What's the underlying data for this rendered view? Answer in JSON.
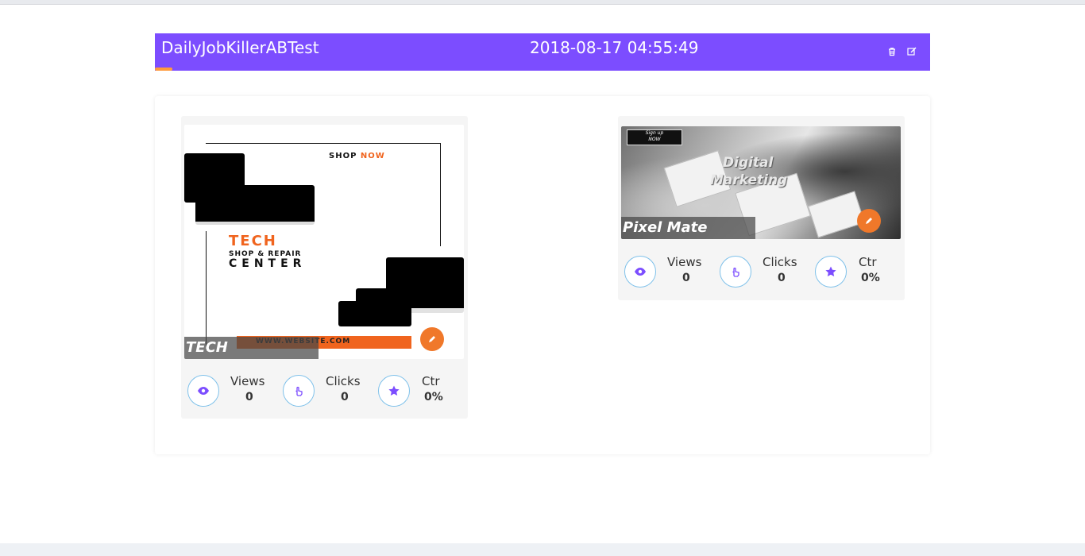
{
  "header": {
    "title": "DailyJobKillerABTest",
    "datetime": "2018-08-17 04:55:49",
    "accent_color": "#7c4dff",
    "underline_color": "#ff9a3c",
    "actions": [
      {
        "icon": "trash-icon"
      },
      {
        "icon": "edit-icon"
      }
    ]
  },
  "cards": [
    {
      "caption": "TECH",
      "artwork": {
        "headline_shop": "SHOP",
        "headline_now": "NOW",
        "title": "TECH",
        "subtitle": "SHOP & REPAIR",
        "center": "CENTER",
        "website": "WWW.WEBSITE.COM"
      },
      "stats": [
        {
          "icon": "eye-icon",
          "label": "Views",
          "value": "0"
        },
        {
          "icon": "pointer-hand-icon",
          "label": "Clicks",
          "value": "0"
        },
        {
          "icon": "star-icon",
          "label": "Ctr",
          "value": "0%"
        }
      ]
    },
    {
      "caption": "Pixel Mate",
      "artwork": {
        "signup_line1": "Sign up",
        "signup_line2": "NOW",
        "title_line1": "Digital",
        "title_line2": "Marketing"
      },
      "stats": [
        {
          "icon": "eye-icon",
          "label": "Views",
          "value": "0"
        },
        {
          "icon": "pointer-hand-icon",
          "label": "Clicks",
          "value": "0"
        },
        {
          "icon": "star-icon",
          "label": "Ctr",
          "value": "0%"
        }
      ]
    }
  ],
  "colors": {
    "edit_button": "#f0782a",
    "stat_icon": "#7c4dff",
    "stat_border": "#7fc1ea",
    "tech_orange": "#f0641e"
  }
}
